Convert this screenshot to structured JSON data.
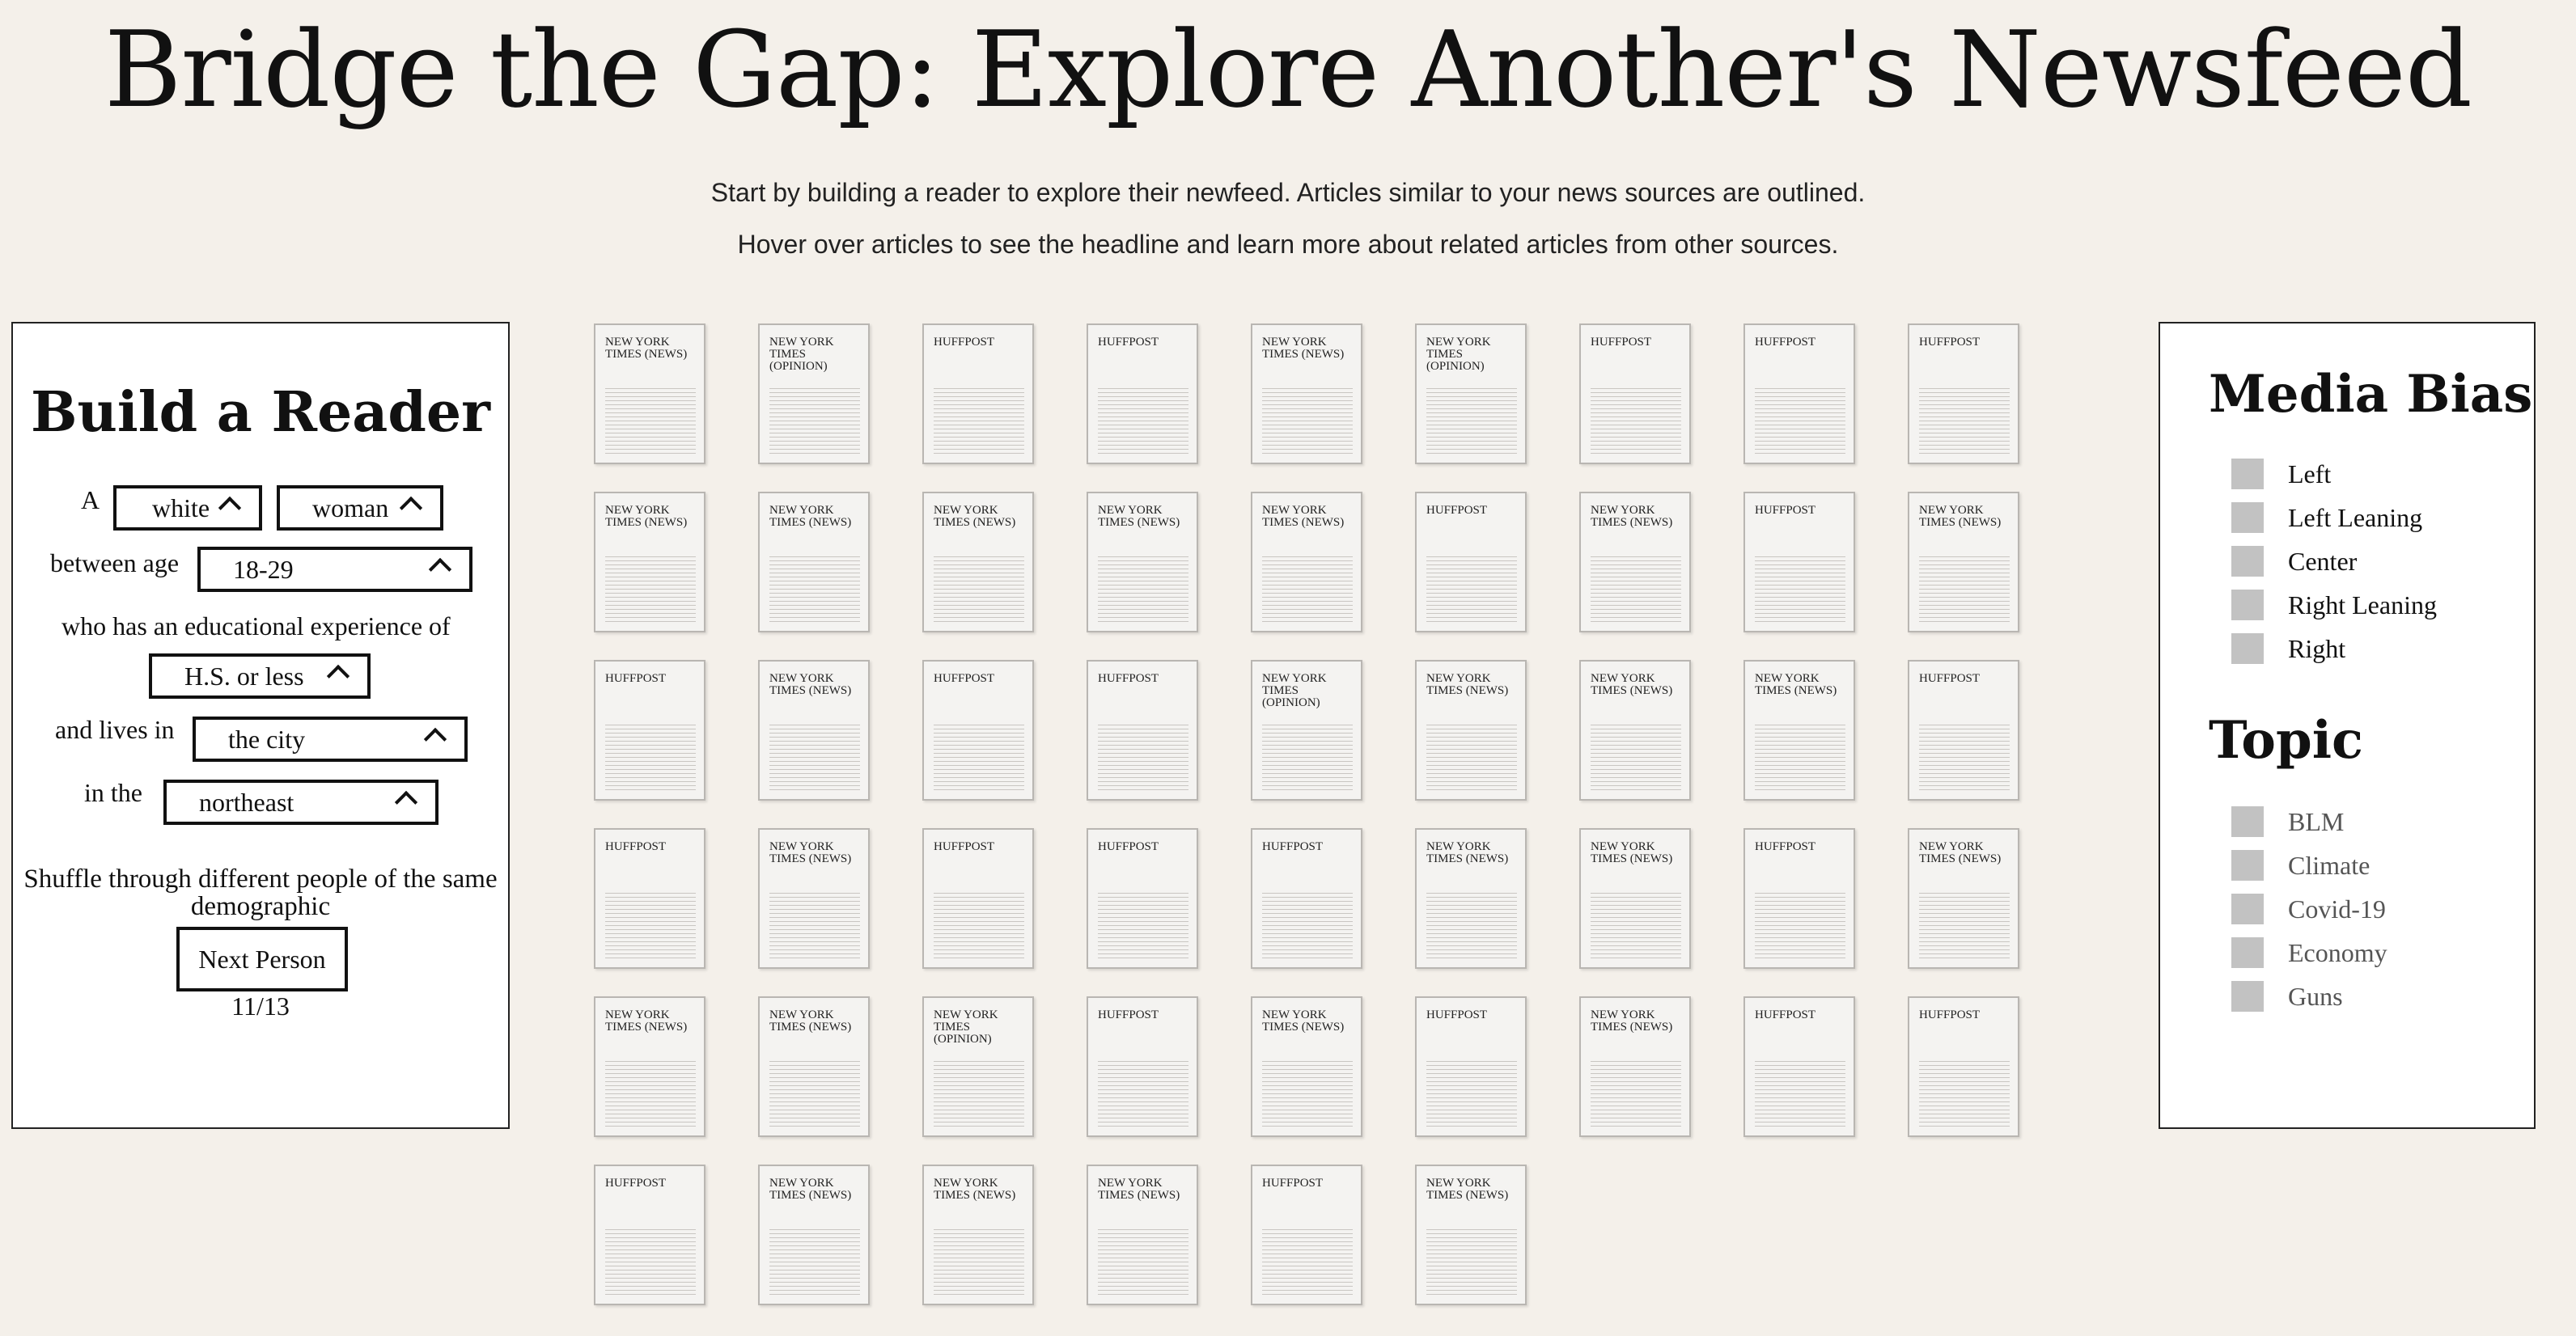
{
  "title": "Bridge the Gap: Explore Another's Newsfeed",
  "subtitle_line1": "Start by building a reader to explore their newfeed. Articles similar to your news sources are outlined.",
  "subtitle_line2": "Hover over articles to see the headline and learn more about related articles from other sources.",
  "reader": {
    "heading": "Build a Reader",
    "a_label": "A",
    "race": "white",
    "gender": "woman",
    "age_label": "between age",
    "age": "18-29",
    "education_label": "who has an educational experience of",
    "education": "H.S. or less",
    "lives_label": "and lives in",
    "area": "the city",
    "region_label": "in the",
    "region": "northeast",
    "shuffle_text": "Shuffle through different people of the same demographic",
    "next_button": "Next Person",
    "counter": "11/13"
  },
  "articles": [
    "NEW YORK TIMES (NEWS)",
    "NEW YORK TIMES (OPINION)",
    "HUFFPOST",
    "HUFFPOST",
    "NEW YORK TIMES (NEWS)",
    "NEW YORK TIMES (OPINION)",
    "HUFFPOST",
    "HUFFPOST",
    "HUFFPOST",
    "NEW YORK TIMES (NEWS)",
    "NEW YORK TIMES (NEWS)",
    "NEW YORK TIMES (NEWS)",
    "NEW YORK TIMES (NEWS)",
    "NEW YORK TIMES (NEWS)",
    "HUFFPOST",
    "NEW YORK TIMES (NEWS)",
    "HUFFPOST",
    "NEW YORK TIMES (NEWS)",
    "HUFFPOST",
    "NEW YORK TIMES (NEWS)",
    "HUFFPOST",
    "HUFFPOST",
    "NEW YORK TIMES (OPINION)",
    "NEW YORK TIMES (NEWS)",
    "NEW YORK TIMES (NEWS)",
    "NEW YORK TIMES (NEWS)",
    "HUFFPOST",
    "HUFFPOST",
    "NEW YORK TIMES (NEWS)",
    "HUFFPOST",
    "HUFFPOST",
    "HUFFPOST",
    "NEW YORK TIMES (NEWS)",
    "NEW YORK TIMES (NEWS)",
    "HUFFPOST",
    "NEW YORK TIMES (NEWS)",
    "NEW YORK TIMES (NEWS)",
    "NEW YORK TIMES (NEWS)",
    "NEW YORK TIMES (OPINION)",
    "HUFFPOST",
    "NEW YORK TIMES (NEWS)",
    "HUFFPOST",
    "NEW YORK TIMES (NEWS)",
    "HUFFPOST",
    "HUFFPOST",
    "HUFFPOST",
    "NEW YORK TIMES (NEWS)",
    "NEW YORK TIMES (NEWS)",
    "NEW YORK TIMES (NEWS)",
    "HUFFPOST",
    "NEW YORK TIMES (NEWS)"
  ],
  "media_bias": {
    "heading": "Media Bias",
    "items": [
      "Left",
      "Left Leaning",
      "Center",
      "Right Leaning",
      "Right"
    ]
  },
  "topic": {
    "heading": "Topic",
    "items": [
      "BLM",
      "Climate",
      "Covid-19",
      "Economy",
      "Guns"
    ]
  },
  "colors": {
    "background": "#f4f0ea",
    "panel": "#ffffff",
    "checkbox": "#c2c2c2"
  }
}
